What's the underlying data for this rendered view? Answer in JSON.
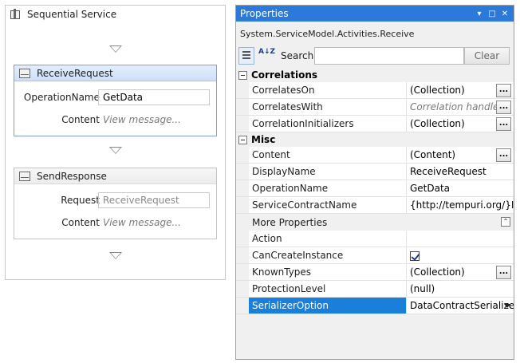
{
  "designer": {
    "sequence_title": "Sequential Service",
    "receive": {
      "title": "ReceiveRequest",
      "operation_label": "OperationName",
      "operation_value": "GetData",
      "content_label": "Content",
      "content_hint": "View message..."
    },
    "send": {
      "title": "SendResponse",
      "request_label": "Request",
      "request_value": "ReceiveRequest",
      "content_label": "Content",
      "content_hint": "View message..."
    }
  },
  "properties": {
    "title": "Properties",
    "title_buttons": [
      "▾",
      "□",
      "✕"
    ],
    "type_name": "System.ServiceModel.Activities.Receive",
    "sort_icon": "A↓Z",
    "search_label": "Search:",
    "search_value": "",
    "clear_label": "Clear",
    "categories": {
      "correlations": {
        "label": "Correlations",
        "rows": [
          {
            "name": "CorrelatesOn",
            "value": "(Collection)",
            "ellipsis": "..."
          },
          {
            "name": "CorrelatesWith",
            "value": "Correlation handle",
            "ellipsis": "..."
          },
          {
            "name": "CorrelationInitializers",
            "value": "(Collection)",
            "ellipsis": "..."
          }
        ]
      },
      "misc": {
        "label": "Misc",
        "rows": [
          {
            "name": "Content",
            "value": "(Content)",
            "ellipsis": "..."
          },
          {
            "name": "DisplayName",
            "value": "ReceiveRequest"
          },
          {
            "name": "OperationName",
            "value": "GetData"
          },
          {
            "name": "ServiceContractName",
            "value": "{http://tempuri.org/}IService"
          }
        ],
        "more_label": "More Properties",
        "more_icon": "⌃",
        "more_rows": [
          {
            "name": "Action",
            "value": ""
          },
          {
            "name": "CanCreateInstance",
            "checked": true
          },
          {
            "name": "KnownTypes",
            "value": "(Collection)",
            "ellipsis": "..."
          },
          {
            "name": "ProtectionLevel",
            "value": "(null)"
          },
          {
            "name": "SerializerOption",
            "value": "DataContractSerializer"
          }
        ]
      }
    }
  }
}
